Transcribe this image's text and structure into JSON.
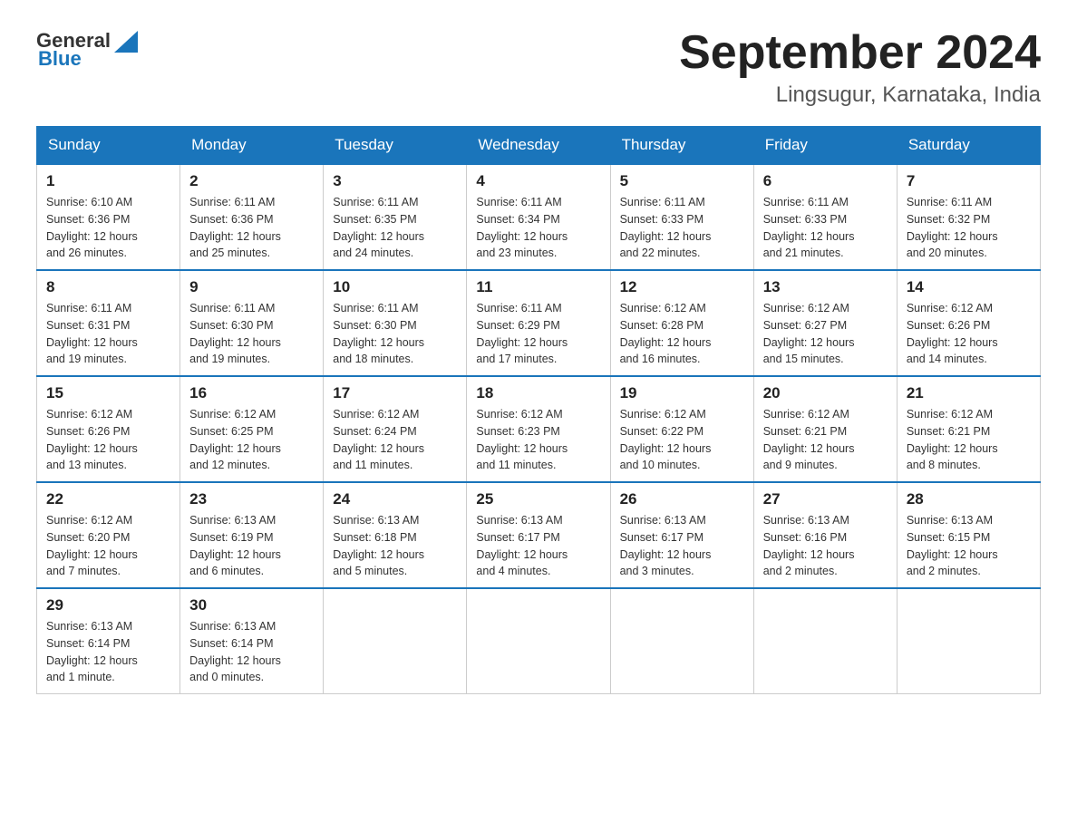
{
  "header": {
    "logo_general": "General",
    "logo_blue": "Blue",
    "title": "September 2024",
    "subtitle": "Lingsugur, Karnataka, India"
  },
  "calendar": {
    "days_of_week": [
      "Sunday",
      "Monday",
      "Tuesday",
      "Wednesday",
      "Thursday",
      "Friday",
      "Saturday"
    ],
    "weeks": [
      [
        {
          "day": "1",
          "sunrise": "6:10 AM",
          "sunset": "6:36 PM",
          "daylight": "12 hours and 26 minutes."
        },
        {
          "day": "2",
          "sunrise": "6:11 AM",
          "sunset": "6:36 PM",
          "daylight": "12 hours and 25 minutes."
        },
        {
          "day": "3",
          "sunrise": "6:11 AM",
          "sunset": "6:35 PM",
          "daylight": "12 hours and 24 minutes."
        },
        {
          "day": "4",
          "sunrise": "6:11 AM",
          "sunset": "6:34 PM",
          "daylight": "12 hours and 23 minutes."
        },
        {
          "day": "5",
          "sunrise": "6:11 AM",
          "sunset": "6:33 PM",
          "daylight": "12 hours and 22 minutes."
        },
        {
          "day": "6",
          "sunrise": "6:11 AM",
          "sunset": "6:33 PM",
          "daylight": "12 hours and 21 minutes."
        },
        {
          "day": "7",
          "sunrise": "6:11 AM",
          "sunset": "6:32 PM",
          "daylight": "12 hours and 20 minutes."
        }
      ],
      [
        {
          "day": "8",
          "sunrise": "6:11 AM",
          "sunset": "6:31 PM",
          "daylight": "12 hours and 19 minutes."
        },
        {
          "day": "9",
          "sunrise": "6:11 AM",
          "sunset": "6:30 PM",
          "daylight": "12 hours and 19 minutes."
        },
        {
          "day": "10",
          "sunrise": "6:11 AM",
          "sunset": "6:30 PM",
          "daylight": "12 hours and 18 minutes."
        },
        {
          "day": "11",
          "sunrise": "6:11 AM",
          "sunset": "6:29 PM",
          "daylight": "12 hours and 17 minutes."
        },
        {
          "day": "12",
          "sunrise": "6:12 AM",
          "sunset": "6:28 PM",
          "daylight": "12 hours and 16 minutes."
        },
        {
          "day": "13",
          "sunrise": "6:12 AM",
          "sunset": "6:27 PM",
          "daylight": "12 hours and 15 minutes."
        },
        {
          "day": "14",
          "sunrise": "6:12 AM",
          "sunset": "6:26 PM",
          "daylight": "12 hours and 14 minutes."
        }
      ],
      [
        {
          "day": "15",
          "sunrise": "6:12 AM",
          "sunset": "6:26 PM",
          "daylight": "12 hours and 13 minutes."
        },
        {
          "day": "16",
          "sunrise": "6:12 AM",
          "sunset": "6:25 PM",
          "daylight": "12 hours and 12 minutes."
        },
        {
          "day": "17",
          "sunrise": "6:12 AM",
          "sunset": "6:24 PM",
          "daylight": "12 hours and 11 minutes."
        },
        {
          "day": "18",
          "sunrise": "6:12 AM",
          "sunset": "6:23 PM",
          "daylight": "12 hours and 11 minutes."
        },
        {
          "day": "19",
          "sunrise": "6:12 AM",
          "sunset": "6:22 PM",
          "daylight": "12 hours and 10 minutes."
        },
        {
          "day": "20",
          "sunrise": "6:12 AM",
          "sunset": "6:21 PM",
          "daylight": "12 hours and 9 minutes."
        },
        {
          "day": "21",
          "sunrise": "6:12 AM",
          "sunset": "6:21 PM",
          "daylight": "12 hours and 8 minutes."
        }
      ],
      [
        {
          "day": "22",
          "sunrise": "6:12 AM",
          "sunset": "6:20 PM",
          "daylight": "12 hours and 7 minutes."
        },
        {
          "day": "23",
          "sunrise": "6:13 AM",
          "sunset": "6:19 PM",
          "daylight": "12 hours and 6 minutes."
        },
        {
          "day": "24",
          "sunrise": "6:13 AM",
          "sunset": "6:18 PM",
          "daylight": "12 hours and 5 minutes."
        },
        {
          "day": "25",
          "sunrise": "6:13 AM",
          "sunset": "6:17 PM",
          "daylight": "12 hours and 4 minutes."
        },
        {
          "day": "26",
          "sunrise": "6:13 AM",
          "sunset": "6:17 PM",
          "daylight": "12 hours and 3 minutes."
        },
        {
          "day": "27",
          "sunrise": "6:13 AM",
          "sunset": "6:16 PM",
          "daylight": "12 hours and 2 minutes."
        },
        {
          "day": "28",
          "sunrise": "6:13 AM",
          "sunset": "6:15 PM",
          "daylight": "12 hours and 2 minutes."
        }
      ],
      [
        {
          "day": "29",
          "sunrise": "6:13 AM",
          "sunset": "6:14 PM",
          "daylight": "12 hours and 1 minute."
        },
        {
          "day": "30",
          "sunrise": "6:13 AM",
          "sunset": "6:14 PM",
          "daylight": "12 hours and 0 minutes."
        },
        null,
        null,
        null,
        null,
        null
      ]
    ]
  }
}
